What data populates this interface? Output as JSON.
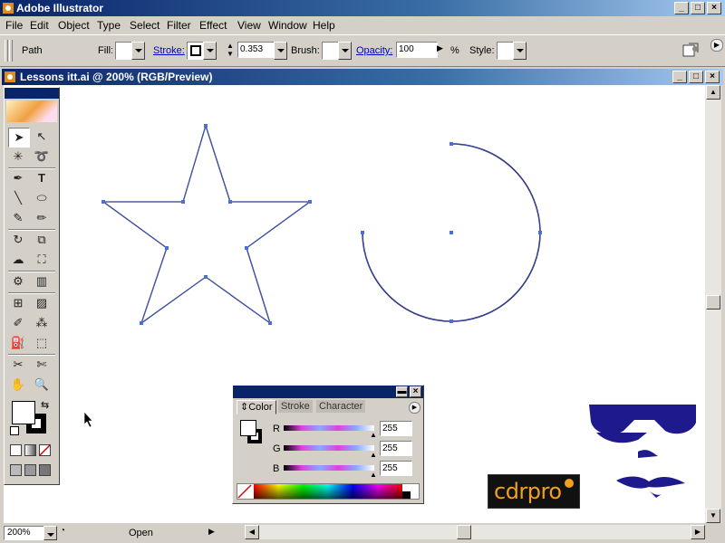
{
  "app": {
    "title": "Adobe Illustrator"
  },
  "menu": [
    "File",
    "Edit",
    "Object",
    "Type",
    "Select",
    "Filter",
    "Effect",
    "View",
    "Window",
    "Help"
  ],
  "control": {
    "selection_label": "Path",
    "fill_label": "Fill:",
    "stroke_label": "Stroke:",
    "stroke_weight": "0.353",
    "brush_label": "Brush:",
    "opacity_label": "Opacity:",
    "opacity_value": "100",
    "percent": "%",
    "style_label": "Style:"
  },
  "document": {
    "title": "Lessons itt.ai @ 200% (RGB/Preview)"
  },
  "status": {
    "zoom": "200%",
    "info": "Open"
  },
  "color_panel": {
    "tabs": [
      "Color",
      "Stroke",
      "Character"
    ],
    "channels": [
      {
        "label": "R",
        "value": "255"
      },
      {
        "label": "G",
        "value": "255"
      },
      {
        "label": "B",
        "value": "255"
      }
    ]
  },
  "watermark": {
    "brand": "cdrpro"
  },
  "colors": {
    "selection": "#4a6fd6",
    "path": "#1a1a5e",
    "titlebar": "#0a246a",
    "mascot": "#1e1a8e"
  }
}
